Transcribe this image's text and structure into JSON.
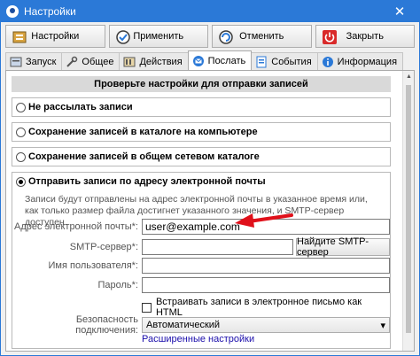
{
  "window": {
    "title": "Настройки",
    "close_glyph": "✕"
  },
  "toolbar": {
    "settings_label": "Настройки",
    "apply_label": "Применить",
    "cancel_label": "Отменить",
    "close_label": "Закрыть",
    "icons": [
      "settings-icon",
      "apply-icon",
      "cancel-icon",
      "power-icon"
    ]
  },
  "tabs": [
    {
      "label": "Запуск",
      "icon": "launch-icon"
    },
    {
      "label": "Общее",
      "icon": "tools-icon"
    },
    {
      "label": "Действия",
      "icon": "actions-icon"
    },
    {
      "label": "Послать",
      "icon": "send-icon",
      "active": true
    },
    {
      "label": "События",
      "icon": "events-icon"
    },
    {
      "label": "Информация",
      "icon": "info-icon"
    }
  ],
  "panel": {
    "header": "Проверьте настройки для отправки записей",
    "options": [
      {
        "label": "Не рассылать записи",
        "checked": false
      },
      {
        "label": "Сохранение записей в каталоге на компьютере",
        "checked": false
      },
      {
        "label": "Сохранение записей в общем сетевом каталоге",
        "checked": false
      }
    ],
    "email": {
      "label": "Отправить записи по адресу электронной почты",
      "checked": true,
      "description": "Записи будут отправлены на адрес электронной почты в указанное время или, как только размер файла достигнет указанного значения, и SMTP-сервер доступен.",
      "fields": {
        "email_label": "Адрес электронной почты*:",
        "email_value": "user@example.com",
        "smtp_label": "SMTP-сервер*:",
        "smtp_value": "",
        "find_smtp_button": "Найдите SMTP-сервер",
        "username_label": "Имя пользователя*:",
        "username_value": "",
        "password_label": "Пароль*:",
        "password_value": ""
      },
      "embed_html_label": "Встраивать записи в электронное письмо как HTML",
      "embed_html_checked": false,
      "security_label": "Безопасность подключения:",
      "security_value": "Автоматический",
      "advanced_link": "Расширенные настройки"
    }
  },
  "colors": {
    "titlebar": "#2b79d7",
    "arrow": "#e0101a",
    "link": "#1a0dab"
  }
}
